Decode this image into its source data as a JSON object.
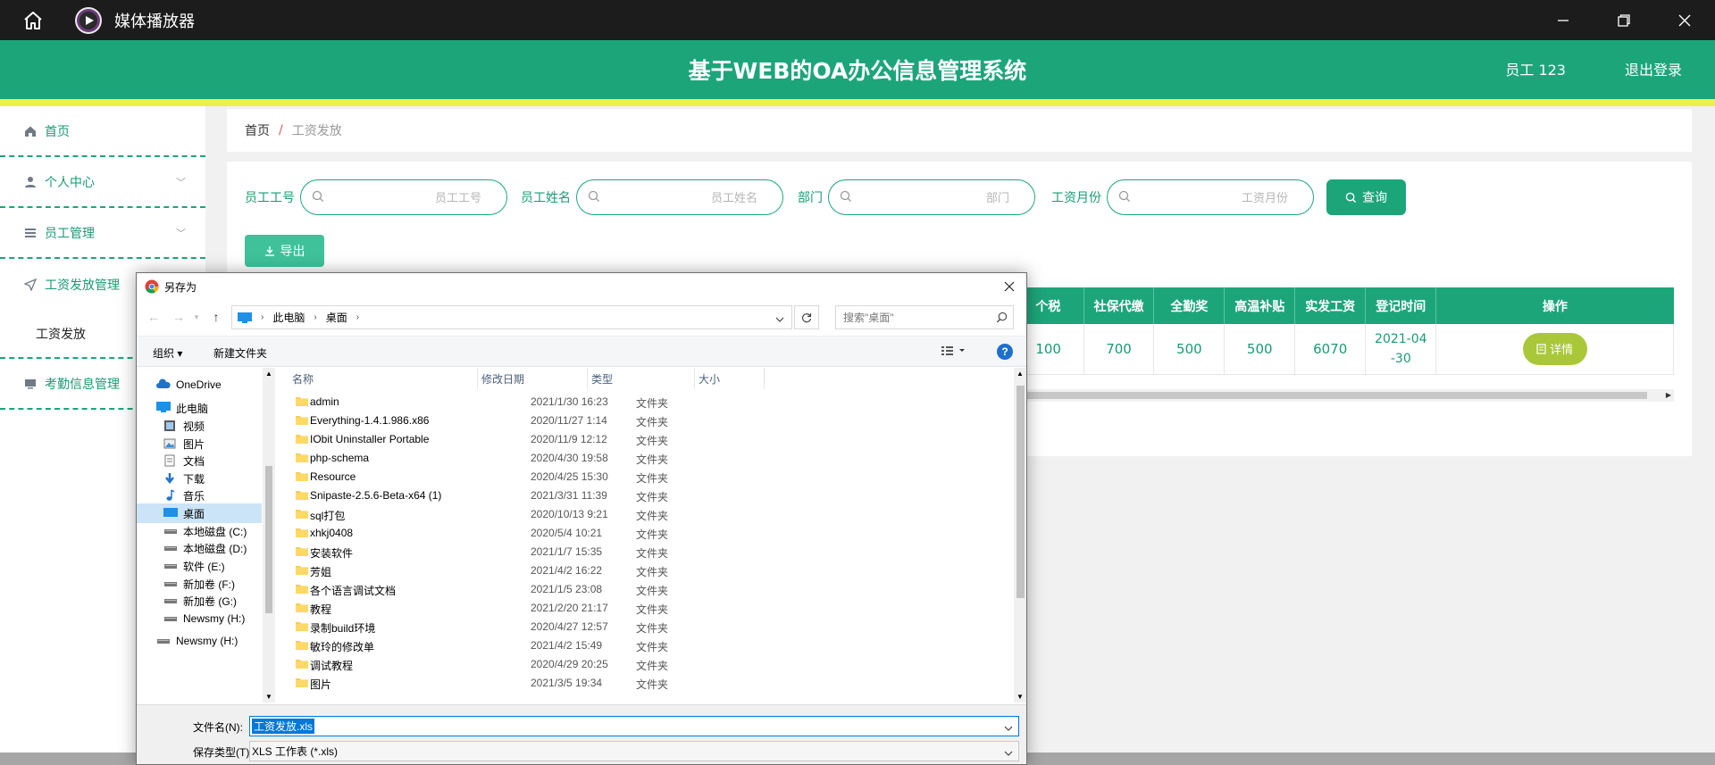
{
  "titlebar": {
    "app_title": "媒体播放器"
  },
  "header": {
    "system_title": "基于WEB的OA办公信息管理系统",
    "user": "员工 123",
    "logout": "退出登录"
  },
  "sidebar": {
    "items": [
      {
        "label": "首页"
      },
      {
        "label": "个人中心"
      },
      {
        "label": "员工管理"
      },
      {
        "label": "工资发放管理"
      },
      {
        "label": "工资发放"
      },
      {
        "label": "考勤信息管理"
      }
    ]
  },
  "breadcrumb": {
    "home": "首页",
    "sep": "/",
    "current": "工资发放"
  },
  "search": {
    "fields": [
      {
        "label": "员工工号",
        "placeholder": "员工工号"
      },
      {
        "label": "员工姓名",
        "placeholder": "员工姓名"
      },
      {
        "label": "部门",
        "placeholder": "部门"
      },
      {
        "label": "工资月份",
        "placeholder": "工资月份"
      }
    ],
    "query_label": "查询",
    "export_label": "导出"
  },
  "table": {
    "headers": [
      "个税",
      "社保代缴",
      "全勤奖",
      "高温补贴",
      "实发工资",
      "登记时间",
      "操作"
    ],
    "row": {
      "tax": "100",
      "social": "700",
      "attendance": "500",
      "heat": "500",
      "net": "6070",
      "date_line1": "2021-04",
      "date_line2": "-30",
      "action": "详情"
    }
  },
  "dialog": {
    "title": "另存为",
    "address": [
      "此电脑",
      "桌面"
    ],
    "search_placeholder": "搜索\"桌面\"",
    "organize": "组织 ▾",
    "new_folder": "新建文件夹",
    "help": "?",
    "columns": {
      "name": "名称",
      "date": "修改日期",
      "type": "类型",
      "size": "大小"
    },
    "tree": [
      {
        "label": "OneDrive",
        "icon": "cloud-icon"
      },
      {
        "label": "此电脑",
        "icon": "computer-icon"
      },
      {
        "label": "视频",
        "icon": "video-icon"
      },
      {
        "label": "图片",
        "icon": "picture-icon"
      },
      {
        "label": "文档",
        "icon": "document-icon"
      },
      {
        "label": "下载",
        "icon": "download-icon"
      },
      {
        "label": "音乐",
        "icon": "music-icon"
      },
      {
        "label": "桌面",
        "icon": "desktop-icon"
      },
      {
        "label": "本地磁盘 (C:)",
        "icon": "drive-icon"
      },
      {
        "label": "本地磁盘 (D:)",
        "icon": "drive-icon"
      },
      {
        "label": "软件 (E:)",
        "icon": "drive-icon"
      },
      {
        "label": "新加卷 (F:)",
        "icon": "drive-icon"
      },
      {
        "label": "新加卷 (G:)",
        "icon": "drive-icon"
      },
      {
        "label": "Newsmy (H:)",
        "icon": "drive-icon"
      },
      {
        "label": "Newsmy (H:)",
        "icon": "drive-icon"
      }
    ],
    "files": [
      {
        "name": "admin",
        "date": "2021/1/30 16:23",
        "type": "文件夹"
      },
      {
        "name": "Everything-1.4.1.986.x86",
        "date": "2020/11/27 1:14",
        "type": "文件夹"
      },
      {
        "name": "IObit Uninstaller Portable",
        "date": "2020/11/9 12:12",
        "type": "文件夹"
      },
      {
        "name": "php-schema",
        "date": "2020/4/30 19:58",
        "type": "文件夹"
      },
      {
        "name": "Resource",
        "date": "2020/4/25 15:30",
        "type": "文件夹"
      },
      {
        "name": "Snipaste-2.5.6-Beta-x64 (1)",
        "date": "2021/3/31 11:39",
        "type": "文件夹"
      },
      {
        "name": "sql打包",
        "date": "2020/10/13 9:21",
        "type": "文件夹"
      },
      {
        "name": "xhkj0408",
        "date": "2020/5/4 10:21",
        "type": "文件夹"
      },
      {
        "name": "安装软件",
        "date": "2021/1/7 15:35",
        "type": "文件夹"
      },
      {
        "name": "芳姐",
        "date": "2021/4/2 16:22",
        "type": "文件夹"
      },
      {
        "name": "各个语言调试文档",
        "date": "2021/1/5 23:08",
        "type": "文件夹"
      },
      {
        "name": "教程",
        "date": "2021/2/20 21:17",
        "type": "文件夹"
      },
      {
        "name": "录制build环境",
        "date": "2020/4/27 12:57",
        "type": "文件夹"
      },
      {
        "name": "敏玲的修改单",
        "date": "2021/4/2 15:49",
        "type": "文件夹"
      },
      {
        "name": "调试教程",
        "date": "2020/4/29 20:25",
        "type": "文件夹"
      },
      {
        "name": "图片",
        "date": "2021/3/5 19:34",
        "type": "文件夹"
      }
    ],
    "filename_label": "文件名(N):",
    "filename_value": "工资发放.xls",
    "filetype_label": "保存类型(T):",
    "filetype_value": "XLS 工作表 (*.xls)"
  },
  "colors": {
    "primary": "#1da57a",
    "accent_yellow": "#eef04a",
    "detail_button": "#a9c739",
    "dialog_highlight": "#0078d7"
  }
}
